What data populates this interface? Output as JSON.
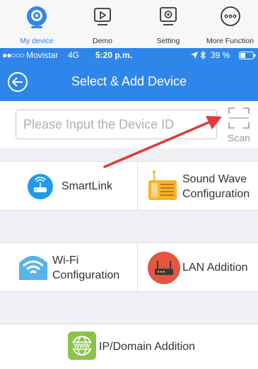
{
  "tabs": [
    {
      "label": "My device",
      "icon": "camera-icon",
      "active": true
    },
    {
      "label": "Demo",
      "icon": "play-screen-icon",
      "active": false
    },
    {
      "label": "Setting",
      "icon": "settings-icon",
      "active": false
    },
    {
      "label": "More Function",
      "icon": "more-icon",
      "active": false
    }
  ],
  "status_bar": {
    "signal": "●●○○○",
    "carrier": "Movistar",
    "network": "4G",
    "time": "5:20 p.m.",
    "battery": "39 %"
  },
  "nav": {
    "title": "Select & Add Device"
  },
  "device_id": {
    "placeholder": "Please Input the Device ID",
    "value": ""
  },
  "scan": {
    "label": "Scan"
  },
  "options": {
    "smartlink": {
      "label": "SmartLink",
      "icon": "smartlink-router-icon"
    },
    "sound_wave": {
      "line1": "Sound Wave",
      "line2": "Configuration",
      "icon": "sound-wave-icon"
    },
    "wifi": {
      "line1": "Wi-Fi",
      "line2": "Configuration",
      "icon": "wifi-icon"
    },
    "lan": {
      "label": "LAN Addition",
      "icon": "lan-router-icon"
    },
    "ip_domain": {
      "label": "IP/Domain Addition",
      "icon": "globe-www-icon"
    }
  },
  "colors": {
    "brand": "#2f86ea",
    "arrow": "#e0393b",
    "divider": "#efeff4"
  }
}
